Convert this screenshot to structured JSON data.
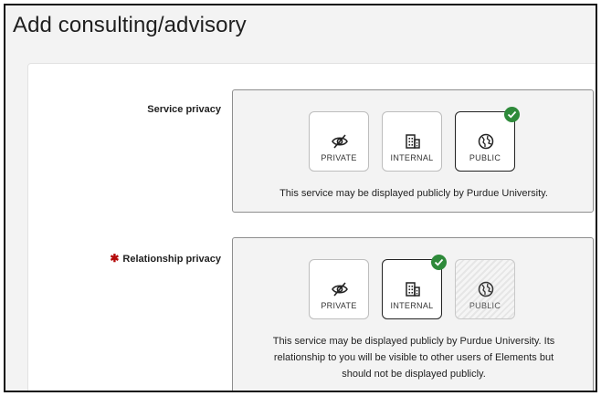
{
  "header": {
    "title": "Add consulting/advisory"
  },
  "service_privacy": {
    "label": "Service privacy",
    "options": [
      {
        "label": "PRIVATE",
        "icon": "eye-off-icon",
        "selected": false
      },
      {
        "label": "INTERNAL",
        "icon": "building-icon",
        "selected": false
      },
      {
        "label": "PUBLIC",
        "icon": "globe-icon",
        "selected": true
      }
    ],
    "note": "This service may be displayed publicly by Purdue University."
  },
  "relationship_privacy": {
    "required_marker": "✱",
    "label": "Relationship privacy",
    "options": [
      {
        "label": "PRIVATE",
        "icon": "eye-off-icon",
        "selected": false,
        "disabled": false
      },
      {
        "label": "INTERNAL",
        "icon": "building-icon",
        "selected": true,
        "disabled": false
      },
      {
        "label": "PUBLIC",
        "icon": "globe-icon",
        "selected": false,
        "disabled": true
      }
    ],
    "note_lines": [
      "This service may be displayed publicly by Purdue University. Its",
      "relationship to you will be visible to other users of Elements but",
      "should not be displayed publicly."
    ]
  },
  "colors": {
    "check": "#2e8a3a",
    "required": "#b40a0a",
    "border": "#8e8e8e"
  }
}
